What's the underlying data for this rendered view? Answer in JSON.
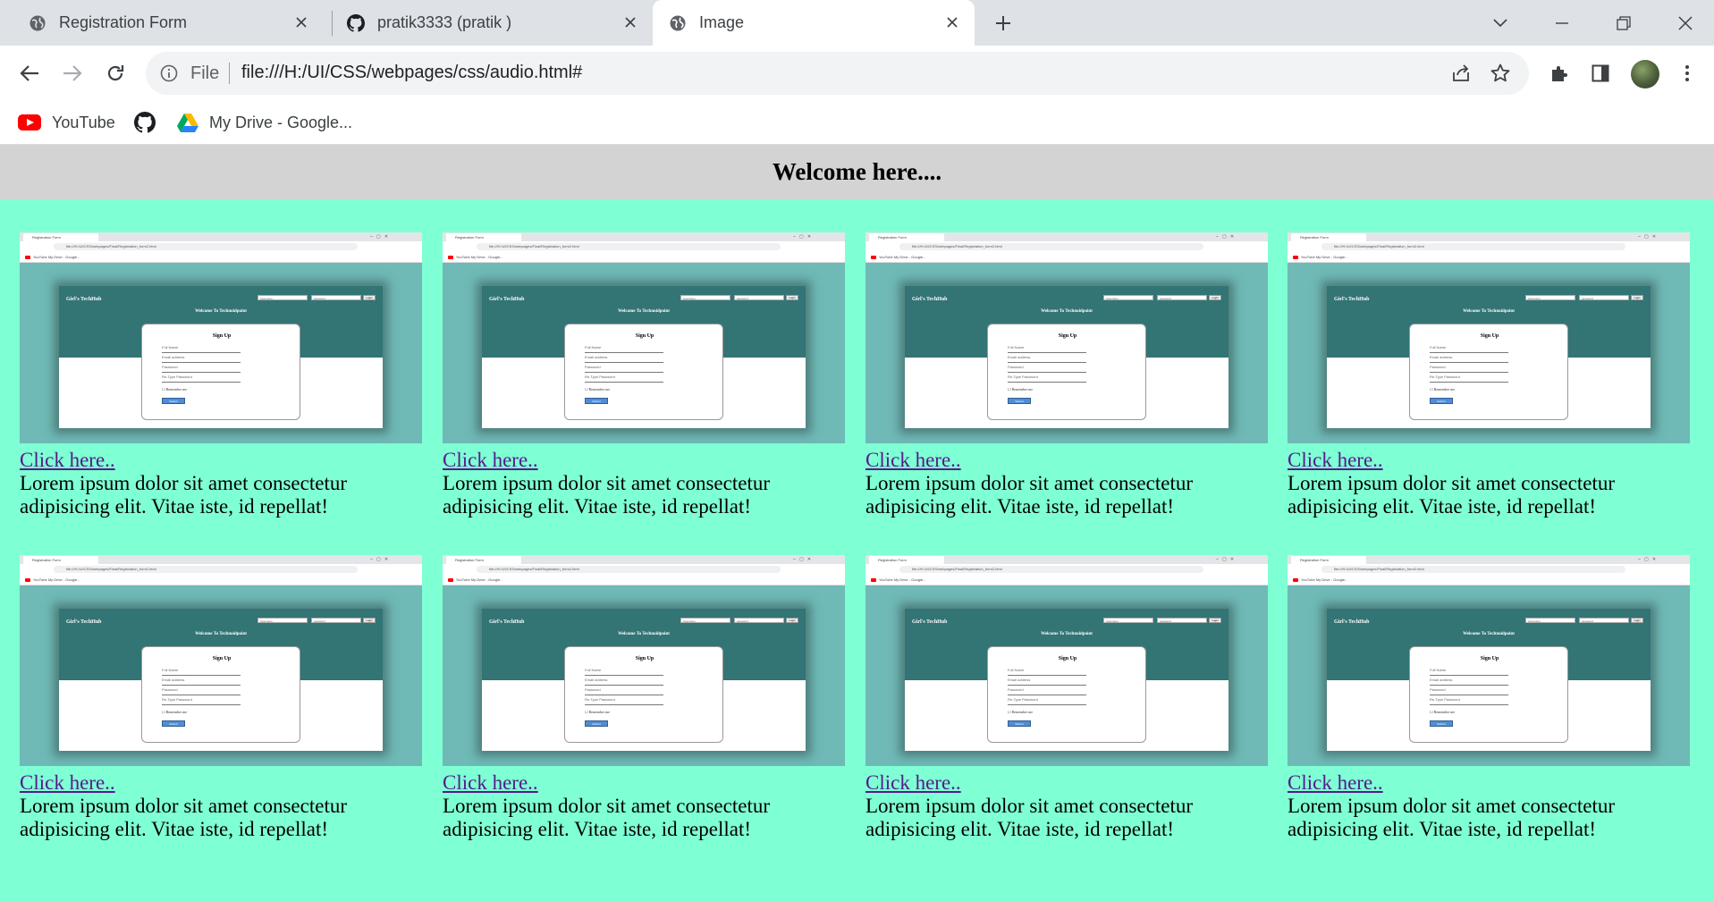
{
  "browser": {
    "tabs": [
      {
        "title": "Registration Form",
        "icon": "globe-icon"
      },
      {
        "title": "pratik3333 (pratik )",
        "icon": "github-icon"
      },
      {
        "title": "Image",
        "icon": "globe-icon",
        "active": true
      }
    ],
    "address": {
      "scheme_label": "File",
      "url": "file:///H:/UI/CSS/webpages/css/audio.html#"
    },
    "bookmarks": [
      {
        "label": "YouTube",
        "icon": "youtube-icon"
      },
      {
        "label": "",
        "icon": "github-icon"
      },
      {
        "label": "My Drive - Google...",
        "icon": "google-drive-icon"
      }
    ]
  },
  "page": {
    "header": "Welcome here....",
    "cards": [
      {
        "link": "Click here..",
        "text": "Lorem ipsum dolor sit amet consectetur adipisicing elit. Vitae iste, id repellat!"
      },
      {
        "link": "Click here..",
        "text": "Lorem ipsum dolor sit amet consectetur adipisicing elit. Vitae iste, id repellat!"
      },
      {
        "link": "Click here..",
        "text": "Lorem ipsum dolor sit amet consectetur adipisicing elit. Vitae iste, id repellat!"
      },
      {
        "link": "Click here..",
        "text": "Lorem ipsum dolor sit amet consectetur adipisicing elit. Vitae iste, id repellat!"
      },
      {
        "link": "Click here..",
        "text": "Lorem ipsum dolor sit amet consectetur adipisicing elit. Vitae iste, id repellat!"
      },
      {
        "link": "Click here..",
        "text": "Lorem ipsum dolor sit amet consectetur adipisicing elit. Vitae iste, id repellat!"
      },
      {
        "link": "Click here..",
        "text": "Lorem ipsum dolor sit amet consectetur adipisicing elit. Vitae iste, id repellat!"
      },
      {
        "link": "Click here..",
        "text": "Lorem ipsum dolor sit amet consectetur adipisicing elit. Vitae iste, id repellat!"
      }
    ]
  },
  "thumbnail": {
    "tab_title": "Registration Form",
    "url": "file:///H:/UI/CSS/webpages/Final/Registration_form2.html",
    "bookmarks": "YouTube   My Drive - Google...",
    "brand": "Girl's TechHub",
    "welcome": "Welcome To Technoidpoint",
    "username_placeholder": "Username",
    "password_placeholder": "password",
    "login": "Login",
    "form_title": "Sign Up",
    "fields": [
      "Full Name",
      "Email address",
      "Password",
      "Re-Type Password"
    ],
    "remember": "Remember me",
    "submit": "Submit"
  },
  "colors": {
    "page_background": "#7fffd4",
    "header_background": "#d3d3d3",
    "link": "#551a8b",
    "thumb_teal": "#337475"
  }
}
